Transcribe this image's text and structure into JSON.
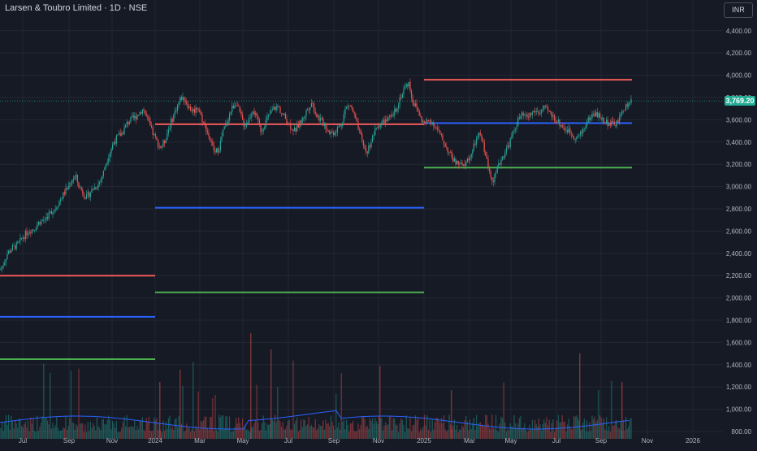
{
  "header": {
    "title": "Larsen & Toubro Limited · 1D · NSE",
    "currency": "INR"
  },
  "colors": {
    "background": "#161a25",
    "grid": "#232735",
    "up_candle": "#26a69a",
    "down_candle": "#ef5350",
    "resistance": "#f05a5a",
    "pivot": "#2962ff",
    "support": "#4caf50",
    "volume_ma": "#2962ff",
    "badge": "#22ab94"
  },
  "current_price": "3,769.20",
  "chart_data": {
    "type": "candlestick",
    "price_ticks": [
      "800.00",
      "1,000.00",
      "1,200.00",
      "1,400.00",
      "1,600.00",
      "1,800.00",
      "2,000.00",
      "2,200.00",
      "2,400.00",
      "2,600.00",
      "2,800.00",
      "3,000.00",
      "3,200.00",
      "3,400.00",
      "3,600.00",
      "3,800.00",
      "4,000.00",
      "4,200.00",
      "4,400.00"
    ],
    "time_ticks": [
      "Jul",
      "Sep",
      "Nov",
      "2024",
      "Mar",
      "May",
      "Jul",
      "Sep",
      "Nov",
      "2025",
      "Mar",
      "May",
      "Jul",
      "Sep",
      "Nov",
      "2026"
    ],
    "price_path": [
      [
        0,
        2250
      ],
      [
        0.03,
        2300
      ],
      [
        0.07,
        2400
      ],
      [
        0.12,
        2450
      ],
      [
        0.17,
        2480
      ],
      [
        0.22,
        2550
      ],
      [
        0.27,
        2600
      ],
      [
        0.32,
        2620
      ],
      [
        0.37,
        2680
      ],
      [
        0.42,
        2700
      ],
      [
        0.47,
        2760
      ],
      [
        0.52,
        2800
      ],
      [
        0.57,
        2880
      ],
      [
        0.62,
        2960
      ],
      [
        0.65,
        3000
      ],
      [
        0.68,
        3060
      ],
      [
        0.72,
        3090
      ],
      [
        0.75,
        3000
      ],
      [
        0.78,
        2960
      ],
      [
        0.82,
        2900
      ],
      [
        0.85,
        2940
      ],
      [
        0.88,
        2980
      ],
      [
        0.92,
        3010
      ],
      [
        0.95,
        3050
      ],
      [
        0.98,
        3120
      ],
      [
        1.0,
        3200
      ],
      [
        1.04,
        3300
      ],
      [
        1.08,
        3400
      ],
      [
        1.12,
        3450
      ],
      [
        1.16,
        3480
      ],
      [
        1.2,
        3560
      ],
      [
        1.24,
        3600
      ],
      [
        1.28,
        3620
      ],
      [
        1.32,
        3660
      ],
      [
        1.36,
        3700
      ],
      [
        1.4,
        3600
      ],
      [
        1.44,
        3500
      ],
      [
        1.48,
        3420
      ],
      [
        1.52,
        3350
      ],
      [
        1.56,
        3400
      ],
      [
        1.6,
        3520
      ],
      [
        1.64,
        3620
      ],
      [
        1.68,
        3720
      ],
      [
        1.72,
        3800
      ],
      [
        1.76,
        3780
      ],
      [
        1.8,
        3700
      ],
      [
        1.84,
        3680
      ],
      [
        1.88,
        3720
      ],
      [
        1.92,
        3600
      ],
      [
        1.96,
        3520
      ],
      [
        2.0,
        3400
      ],
      [
        2.04,
        3300
      ],
      [
        2.08,
        3350
      ],
      [
        2.12,
        3500
      ],
      [
        2.16,
        3600
      ],
      [
        2.2,
        3700
      ],
      [
        2.24,
        3760
      ],
      [
        2.28,
        3650
      ],
      [
        2.32,
        3550
      ],
      [
        2.36,
        3600
      ],
      [
        2.4,
        3700
      ],
      [
        2.44,
        3600
      ],
      [
        2.48,
        3500
      ],
      [
        2.52,
        3580
      ],
      [
        2.56,
        3650
      ],
      [
        2.6,
        3700
      ],
      [
        2.64,
        3720
      ],
      [
        2.68,
        3650
      ],
      [
        2.72,
        3600
      ],
      [
        2.76,
        3540
      ],
      [
        2.8,
        3500
      ],
      [
        2.84,
        3560
      ],
      [
        2.88,
        3620
      ],
      [
        2.92,
        3700
      ],
      [
        2.96,
        3760
      ],
      [
        3.0,
        3650
      ],
      [
        3.04,
        3600
      ],
      [
        3.08,
        3560
      ],
      [
        3.12,
        3500
      ],
      [
        3.16,
        3480
      ],
      [
        3.2,
        3520
      ],
      [
        3.24,
        3560
      ],
      [
        3.28,
        3700
      ],
      [
        3.32,
        3740
      ],
      [
        3.36,
        3650
      ],
      [
        3.4,
        3520
      ],
      [
        3.44,
        3400
      ],
      [
        3.48,
        3300
      ],
      [
        3.52,
        3400
      ],
      [
        3.56,
        3500
      ],
      [
        3.6,
        3560
      ],
      [
        3.64,
        3580
      ],
      [
        3.68,
        3600
      ],
      [
        3.72,
        3620
      ],
      [
        3.76,
        3700
      ],
      [
        3.8,
        3800
      ],
      [
        3.84,
        3880
      ],
      [
        3.88,
        3940
      ],
      [
        3.92,
        3760
      ],
      [
        3.96,
        3700
      ],
      [
        4.0,
        3600
      ],
      [
        4.04,
        3560
      ],
      [
        4.08,
        3600
      ],
      [
        4.12,
        3560
      ],
      [
        4.16,
        3500
      ],
      [
        4.2,
        3420
      ],
      [
        4.24,
        3350
      ],
      [
        4.28,
        3280
      ],
      [
        4.32,
        3220
      ],
      [
        4.36,
        3200
      ],
      [
        4.4,
        3180
      ],
      [
        4.44,
        3240
      ],
      [
        4.48,
        3300
      ],
      [
        4.52,
        3420
      ],
      [
        4.56,
        3470
      ],
      [
        4.6,
        3330
      ],
      [
        4.64,
        3150
      ],
      [
        4.68,
        3060
      ],
      [
        4.72,
        3150
      ],
      [
        4.76,
        3250
      ],
      [
        4.8,
        3320
      ],
      [
        4.84,
        3400
      ],
      [
        4.88,
        3500
      ],
      [
        4.92,
        3600
      ],
      [
        4.96,
        3640
      ],
      [
        5.0,
        3620
      ],
      [
        5.04,
        3650
      ],
      [
        5.08,
        3680
      ],
      [
        5.12,
        3660
      ],
      [
        5.16,
        3700
      ],
      [
        5.2,
        3680
      ],
      [
        5.24,
        3640
      ],
      [
        5.28,
        3600
      ],
      [
        5.32,
        3560
      ],
      [
        5.36,
        3520
      ],
      [
        5.4,
        3500
      ],
      [
        5.44,
        3460
      ],
      [
        5.48,
        3440
      ],
      [
        5.52,
        3480
      ],
      [
        5.56,
        3560
      ],
      [
        5.6,
        3620
      ],
      [
        5.64,
        3660
      ],
      [
        5.68,
        3640
      ],
      [
        5.72,
        3600
      ],
      [
        5.76,
        3580
      ],
      [
        5.8,
        3560
      ],
      [
        5.84,
        3560
      ],
      [
        5.88,
        3600
      ],
      [
        5.92,
        3700
      ],
      [
        5.96,
        3740
      ],
      [
        6.0,
        3769.2
      ]
    ],
    "pivot_levels": [
      {
        "period": "2023",
        "resistance": 2200,
        "pivot": 1830,
        "support": 1450
      },
      {
        "period": "2024",
        "resistance": 3560,
        "pivot": 2810,
        "support": 2050
      },
      {
        "period": "2025",
        "resistance": 3960,
        "pivot": 3570,
        "support": 3170
      }
    ]
  }
}
